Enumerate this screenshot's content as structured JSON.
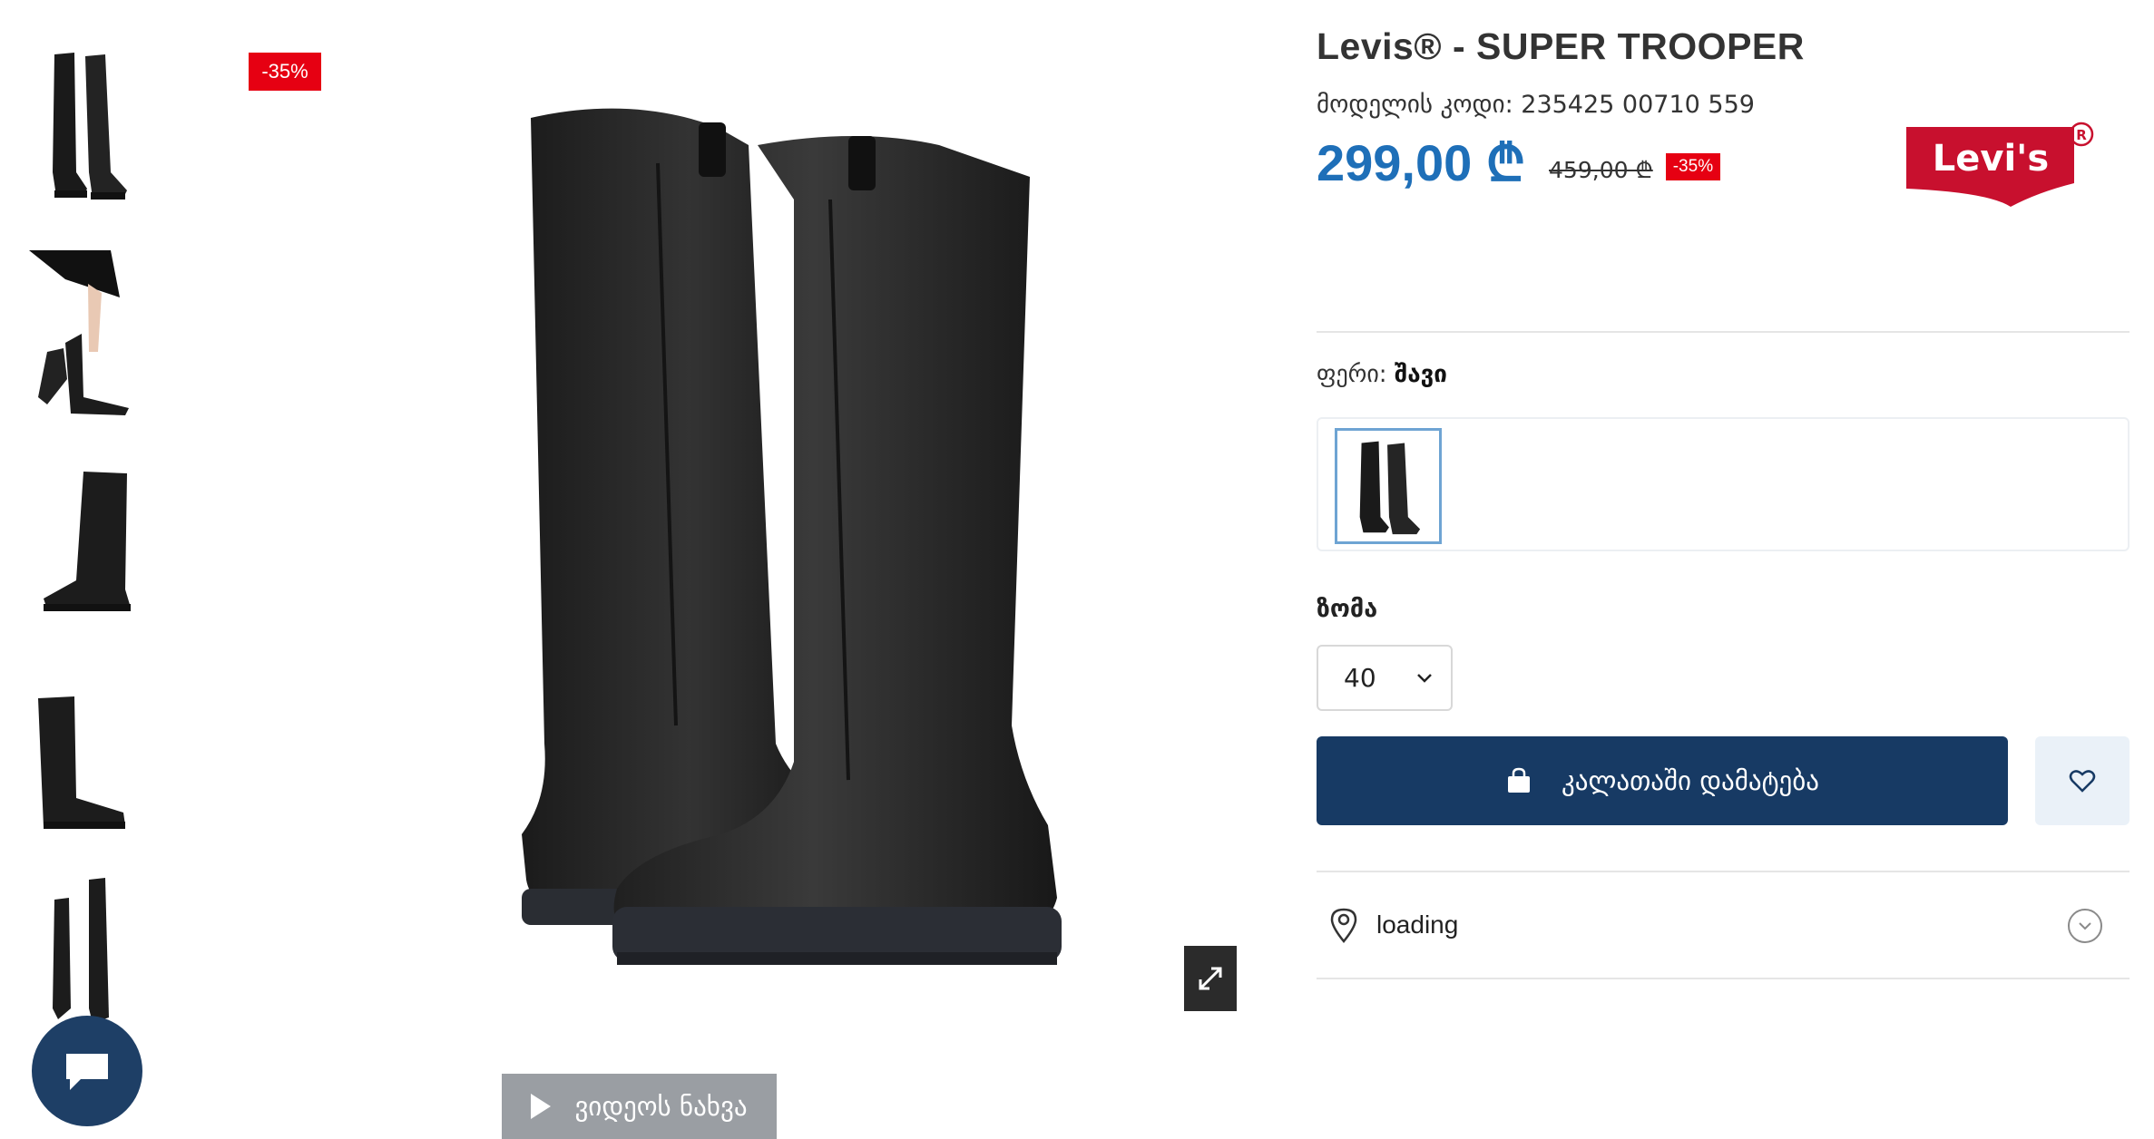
{
  "product": {
    "title": "Levis® - SUPER TROOPER",
    "model_code": "მოდელის კოდი: 235425 00710 559",
    "price_new": "299,00 ₾",
    "price_old": "459,00 ₾",
    "discount": "-35%",
    "image_discount": "-35%",
    "brand_logo_text": "Levi's"
  },
  "color": {
    "label": "ფერი: ",
    "value": "შავი"
  },
  "size": {
    "label": "ზომა",
    "selected": "40"
  },
  "actions": {
    "add_to_cart": "კალათაში დამატება",
    "video": "ვიდეოს ნახვა"
  },
  "store": {
    "status": "loading"
  },
  "colors": {
    "price": "#1e6fb8",
    "cart_button": "#173a64",
    "badge": "#e60012",
    "chat": "#1e3f66"
  },
  "icons": [
    "expand-icon",
    "play-icon",
    "chat-icon",
    "bag-icon",
    "heart-icon",
    "location-pin-icon",
    "chevron-down-icon"
  ]
}
